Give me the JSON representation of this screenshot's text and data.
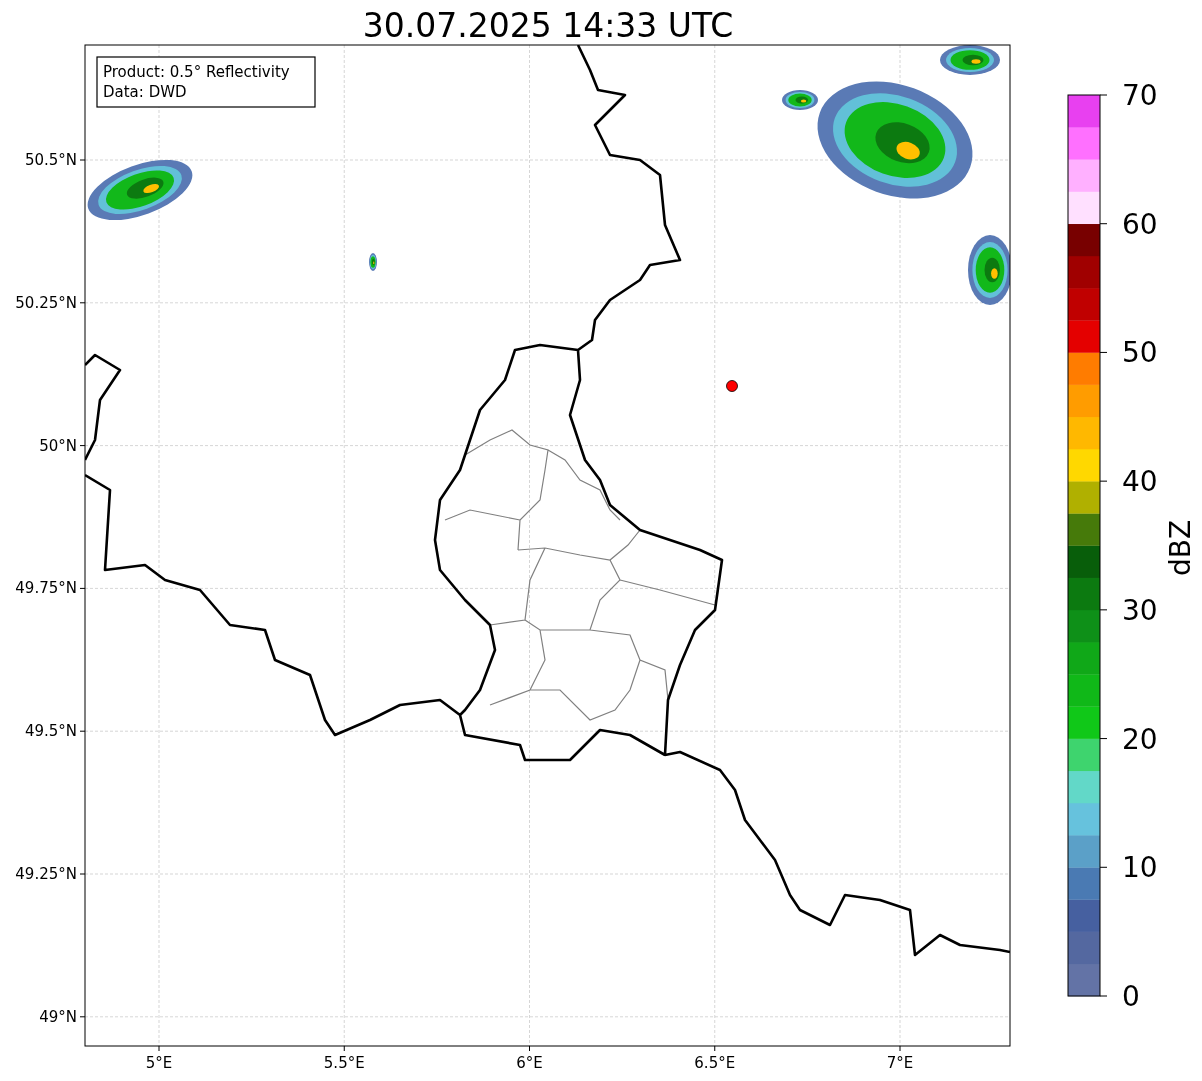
{
  "title": "30.07.2025 14:33 UTC",
  "info_box": [
    "Product: 0.5° Reflectivity",
    "Data: DWD"
  ],
  "lat_ticks": [
    "50.5°N",
    "50.25°N",
    "50°N",
    "49.75°N",
    "49.5°N",
    "49.25°N",
    "49°N"
  ],
  "lon_ticks": [
    "5°E",
    "5.5°E",
    "6°E",
    "6.5°E",
    "7°E"
  ],
  "colorbar": {
    "label": "dBZ",
    "ticks": [
      "70",
      "60",
      "50",
      "40",
      "30",
      "20",
      "10",
      "0"
    ],
    "segments": [
      {
        "color": "#6373a6"
      },
      {
        "color": "#5468a0"
      },
      {
        "color": "#4660a0"
      },
      {
        "color": "#4a7ab3"
      },
      {
        "color": "#5ba0c8"
      },
      {
        "color": "#66c2dd"
      },
      {
        "color": "#62d8c8"
      },
      {
        "color": "#3ed46e"
      },
      {
        "color": "#10c818"
      },
      {
        "color": "#10b818"
      },
      {
        "color": "#10a818"
      },
      {
        "color": "#0e9018"
      },
      {
        "color": "#0c7a10"
      },
      {
        "color": "#085e0a"
      },
      {
        "color": "#467a0a"
      },
      {
        "color": "#b0b000"
      },
      {
        "color": "#ffd800"
      },
      {
        "color": "#ffb800"
      },
      {
        "color": "#ff9c00"
      },
      {
        "color": "#ff7c00"
      },
      {
        "color": "#e40000"
      },
      {
        "color": "#c00000"
      },
      {
        "color": "#a00000"
      },
      {
        "color": "#780000"
      },
      {
        "color": "#ffe0ff"
      },
      {
        "color": "#ffb0ff"
      },
      {
        "color": "#ff70ff"
      },
      {
        "color": "#e840f0"
      }
    ]
  }
}
